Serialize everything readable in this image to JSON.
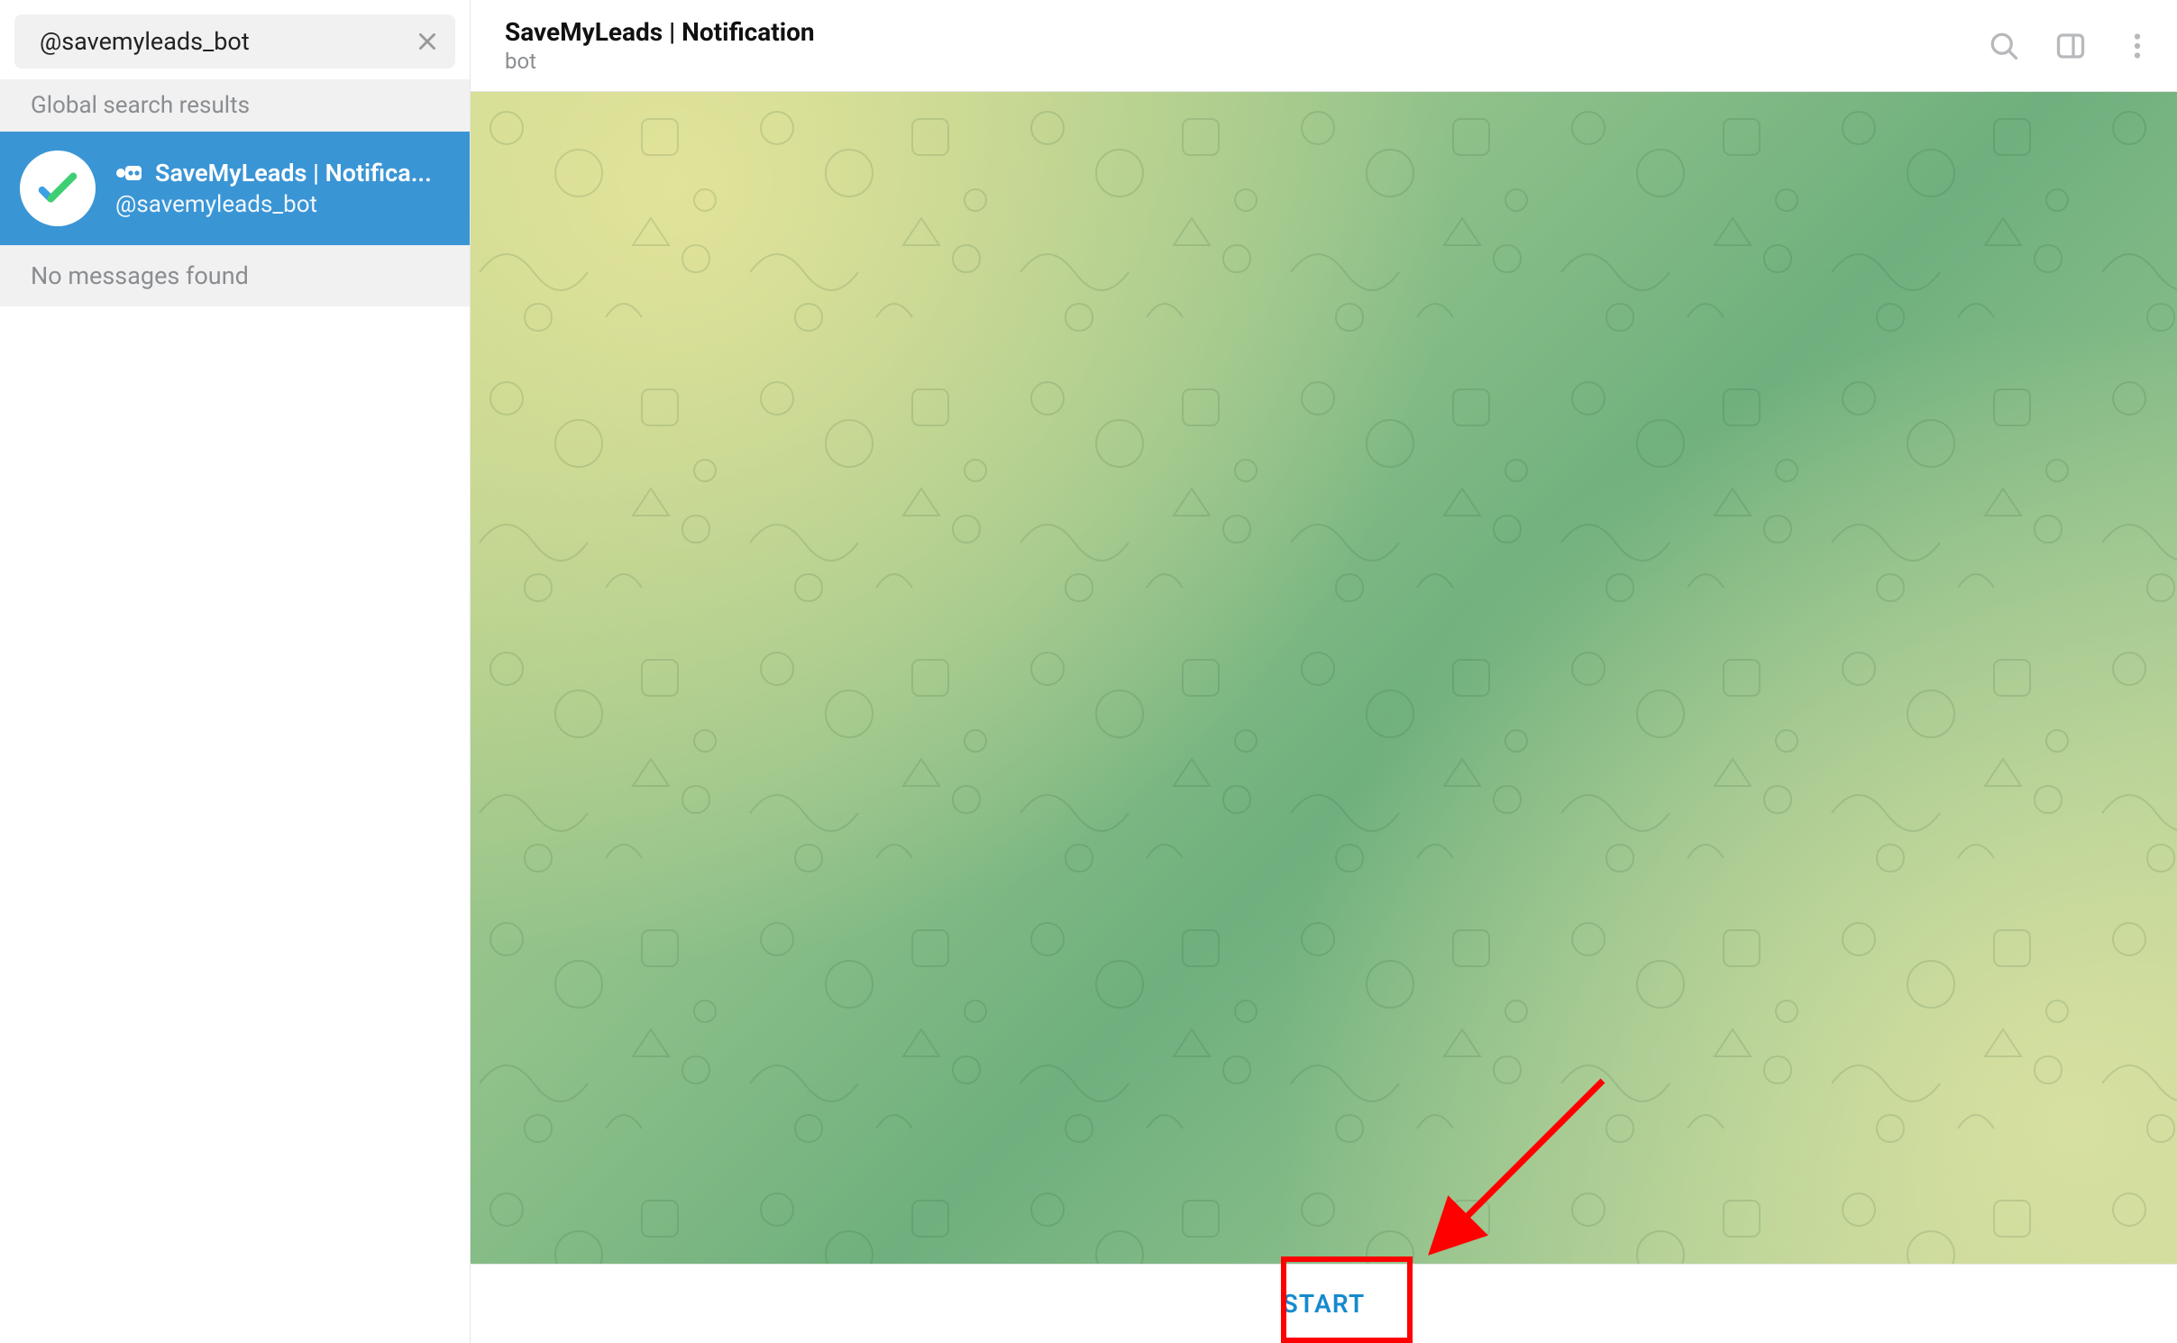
{
  "search": {
    "value": "@savemyleads_bot"
  },
  "sections": {
    "global": "Global search results",
    "nomsg": "No messages found"
  },
  "results": [
    {
      "name": "SaveMyLeads | Notifica...",
      "handle": "@savemyleads_bot",
      "selected": true
    }
  ],
  "header": {
    "title": "SaveMyLeads | Notification",
    "subtitle": "bot"
  },
  "footer": {
    "start": "START"
  },
  "colors": {
    "accent": "#168acd",
    "selection": "#3a95d5",
    "red": "#ff0000"
  }
}
